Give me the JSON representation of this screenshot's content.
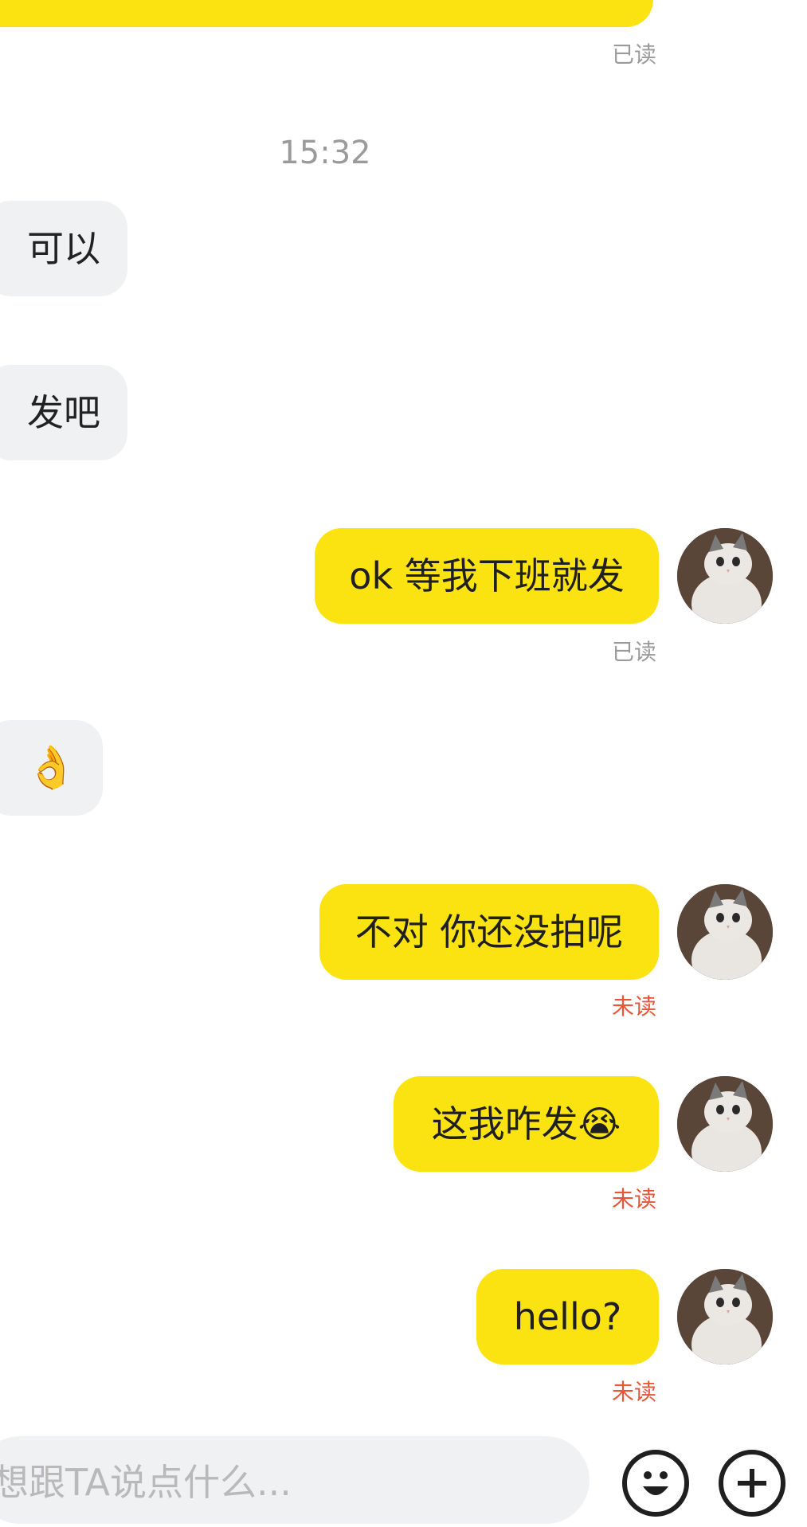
{
  "messages": {
    "top_receipt": "已读",
    "timestamp": "15:32",
    "m1": "可以",
    "m2": "发吧",
    "m3": "ok 等我下班就发",
    "m3_receipt": "已读",
    "m4_emoji": "👌",
    "m5": "不对 你还没拍呢",
    "m5_receipt": "未读",
    "m6": "这我咋发😭",
    "m6_receipt": "未读",
    "m7": "hello?",
    "m7_receipt": "未读"
  },
  "input": {
    "placeholder": "想跟TA说点什么..."
  },
  "icons": {
    "emoji_button": "smiley-face-icon",
    "plus_button": "plus-circle-icon",
    "avatar": "cat-avatar"
  },
  "colors": {
    "my_bubble": "#fbe211",
    "their_bubble": "#f0f1f3",
    "unread": "#e8563a",
    "read": "#9a9a9a"
  }
}
